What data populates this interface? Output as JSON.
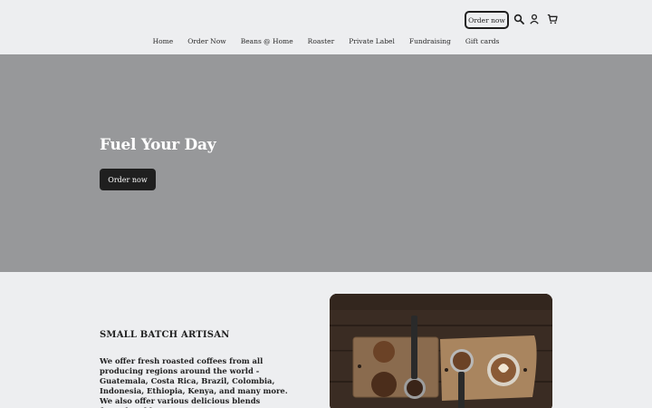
{
  "header": {
    "order_button": "Order now",
    "icons": [
      "search-icon",
      "account-icon",
      "cart-icon"
    ]
  },
  "nav": {
    "items": [
      "Home",
      "Order Now",
      "Beans @ Home",
      "Roaster",
      "Private Label",
      "Fundraising",
      "Gift cards"
    ]
  },
  "hero": {
    "title": "Fuel Your Day",
    "button": "Order now",
    "background_color": "#97989a"
  },
  "intro": {
    "eyebrow": "SMALL BATCH ARTISAN",
    "description": "We offer fresh roasted coffees from all producing regions around the world - Guatemala, Costa Rica, Brazil, Colombia, Indonesia, Ethiopia, Kenya, and many more. We also offer various delicious blends formulated by our Roast Master."
  },
  "colors": {
    "accent_dark": "#1f1f1f",
    "page_bg": "#edeef0"
  }
}
